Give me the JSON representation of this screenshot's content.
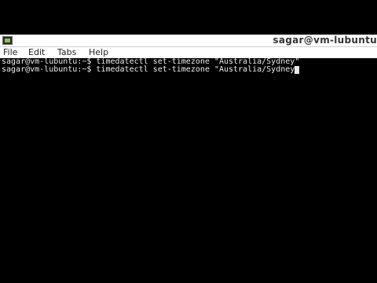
{
  "window": {
    "title": "sagar@vm-lubuntu"
  },
  "menu": {
    "items": [
      "File",
      "Edit",
      "Tabs",
      "Help"
    ]
  },
  "terminal": {
    "lines": [
      {
        "prompt": "sagar@vm-lubuntu:~$",
        "command": "timedatectl set-timezone \"Australia/Sydney\""
      },
      {
        "prompt": "sagar@vm-lubuntu:~$",
        "command": "timedatectl set-timezone \"Australia/Sydney"
      }
    ]
  },
  "colors": {
    "background": "#000000",
    "text": "#ededed",
    "bar": "#ffffff"
  },
  "icons": {
    "app": "terminal-app-icon"
  }
}
